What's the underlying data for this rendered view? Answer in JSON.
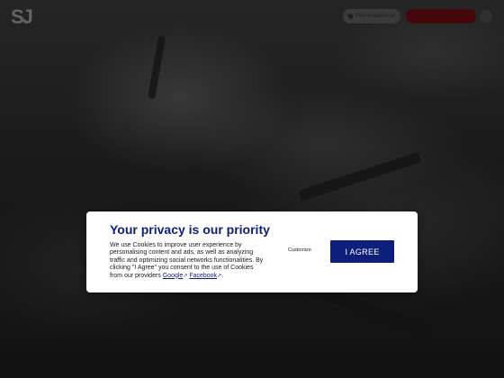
{
  "header": {
    "logo_text": "SJ",
    "location_button_label": "Find a workshop",
    "cta_button_label": "Get a repair quote",
    "menu_icon": "menu-icon"
  },
  "consent": {
    "title": "Your privacy is our priority",
    "body_part1": "We use Cookies to improve user experience by personalising content and ads, as well as analyzing traffic and optimizing social networks functionalities. By clicking \"I Agree\" you consent to the use of Cookies from our providers ",
    "link_google": "Google",
    "body_sep": " ",
    "link_facebook": "Facebook",
    "body_end": ".",
    "external_icon": "external-link-icon",
    "customize_label": "Customize",
    "agree_label": "I AGREE"
  },
  "footer": {
    "text": ""
  },
  "colors": {
    "brand_blue": "#0d1f7a",
    "brand_red": "#c8102e"
  }
}
